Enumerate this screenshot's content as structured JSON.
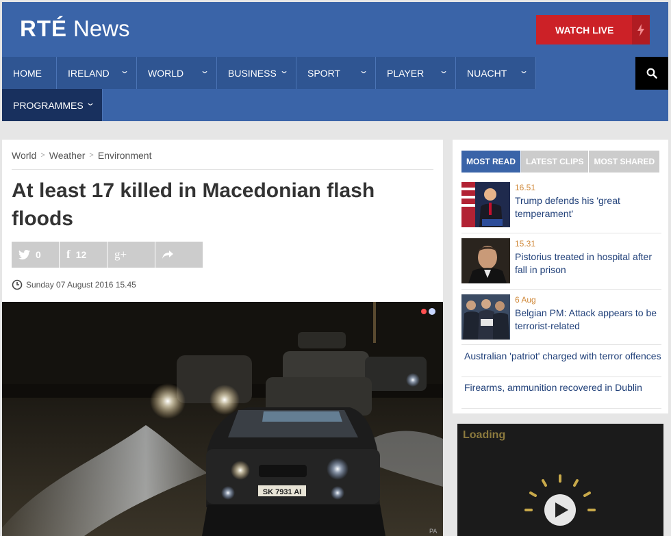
{
  "header": {
    "logo_rte": "RTÉ",
    "logo_news": "News",
    "watch_live": "WATCH LIVE"
  },
  "nav": {
    "items": [
      {
        "label": "HOME",
        "has_dropdown": false
      },
      {
        "label": "IRELAND",
        "has_dropdown": true
      },
      {
        "label": "WORLD",
        "has_dropdown": true
      },
      {
        "label": "BUSINESS",
        "has_dropdown": true
      },
      {
        "label": "SPORT",
        "has_dropdown": true
      },
      {
        "label": "PLAYER",
        "has_dropdown": true
      },
      {
        "label": "NUACHT",
        "has_dropdown": true
      },
      {
        "label": "PROGRAMMES",
        "has_dropdown": true
      }
    ],
    "search_icon": "search-icon"
  },
  "article": {
    "breadcrumb": [
      "World",
      "Weather",
      "Environment"
    ],
    "headline": "At least 17 killed in Macedonian flash floods",
    "shares": {
      "twitter": "0",
      "facebook": "12"
    },
    "date": "Sunday 07 August 2016 15.45",
    "photo_credit": "PA",
    "plate": "SK 7931 AI"
  },
  "sidebar": {
    "tabs": [
      "MOST READ",
      "LATEST CLIPS",
      "MOST SHARED"
    ],
    "stories": [
      {
        "time": "16.51",
        "title": "Trump defends his 'great temperament'"
      },
      {
        "time": "15.31",
        "title": "Pistorius treated in hospital after fall in prison"
      },
      {
        "time": "6 Aug",
        "title": "Belgian PM: Attack appears to be terrorist-related"
      }
    ],
    "plain_stories": [
      "Australian 'patriot' charged with terror offences",
      "Firearms, ammunition recovered in Dublin"
    ]
  },
  "video": {
    "loading": "Loading"
  },
  "colors": {
    "brand_blue": "#3a64a8",
    "watch_live_red": "#cc2127",
    "time_orange": "#d0893a"
  }
}
